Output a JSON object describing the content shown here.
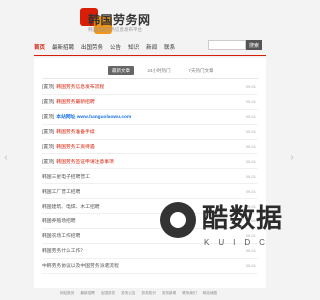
{
  "header": {
    "title": "韩国劳务网",
    "subtitle": "韩国出国劳务信息发布平台"
  },
  "nav": {
    "items": [
      "首页",
      "最新招聘",
      "出国劳务",
      "公告",
      "知识",
      "新闻",
      "联系"
    ],
    "search_button": "搜索"
  },
  "tabs": [
    "最新文章",
    "24小时热门",
    "7天热门文章"
  ],
  "articles": [
    {
      "tag": "[置顶]",
      "title": "韩国劳务信息发布流程",
      "color": "red",
      "date": "09-01"
    },
    {
      "tag": "[置顶]",
      "title": "韩国劳务最新招聘",
      "color": "red",
      "date": "09-01"
    },
    {
      "tag": "[置顶]",
      "title": "本站网址 www.hanguolaowu.com",
      "color": "blue",
      "date": "09-01"
    },
    {
      "tag": "[置顶]",
      "title": "韩国劳务准备手续",
      "color": "red",
      "date": "09-01"
    },
    {
      "tag": "[置顶]",
      "title": "韩国劳务工资待遇",
      "color": "red",
      "date": "09-01"
    },
    {
      "tag": "[置顶]",
      "title": "韩国劳务签证申请注意事项",
      "color": "red",
      "date": "09-01"
    },
    {
      "tag": "",
      "title": "韩国三星电子招聘普工",
      "color": "dark",
      "date": "09-01"
    },
    {
      "tag": "",
      "title": "韩国工厂普工招聘",
      "color": "dark",
      "date": "09-01"
    },
    {
      "tag": "",
      "title": "韩国建筑、电焊、木工招聘",
      "color": "dark",
      "date": "09-01"
    },
    {
      "tag": "",
      "title": "韩国养殖场招聘",
      "color": "dark",
      "date": "09-01"
    },
    {
      "tag": "",
      "title": "韩国农场工作招聘",
      "color": "dark",
      "date": "09-01"
    },
    {
      "tag": "",
      "title": "韩国劳务什么工作？",
      "color": "dark",
      "date": "09-01"
    },
    {
      "tag": "",
      "title": "中韩劳务协议以及中国劳务派遣流程",
      "color": "dark",
      "date": "09-01"
    }
  ],
  "watermark": {
    "text": "酷数据",
    "latin": "KUIDC"
  },
  "footer": {
    "links": [
      "网站首页",
      "最新招聘",
      "出国劳务",
      "劳务公告",
      "劳务知识",
      "劳务新闻",
      "联系我们",
      "网站地图"
    ]
  }
}
